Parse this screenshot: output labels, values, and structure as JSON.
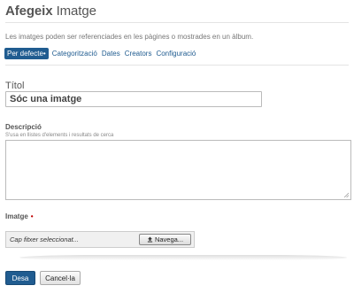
{
  "page": {
    "title_bold": "Afegeix",
    "title_rest": "Imatge",
    "description": "Les imatges poden ser referenciades en les pàgines o mostrades en un àlbum."
  },
  "tabs": [
    {
      "label": "Per defecte•",
      "active": true
    },
    {
      "label": "Categorització",
      "active": false
    },
    {
      "label": "Dates",
      "active": false
    },
    {
      "label": "Creators",
      "active": false
    },
    {
      "label": "Configuració",
      "active": false
    }
  ],
  "fields": {
    "title": {
      "label": "Títol",
      "value": "Sóc una imatge"
    },
    "description": {
      "label": "Descripció",
      "help": "S'usa en llistes d'elements i resultats de cerca",
      "value": ""
    },
    "image": {
      "label": "Imatge",
      "required_marker": "•",
      "no_file_text": "Cap fitxer seleccionat...",
      "browse_label": "Navega..."
    }
  },
  "actions": {
    "save_label": "Desa",
    "cancel_label": "Cancel·la"
  },
  "colors": {
    "accent": "#205c90",
    "required": "#c00000"
  },
  "icons": {
    "browse": "upload-icon",
    "resize": "resize-grip-icon"
  }
}
